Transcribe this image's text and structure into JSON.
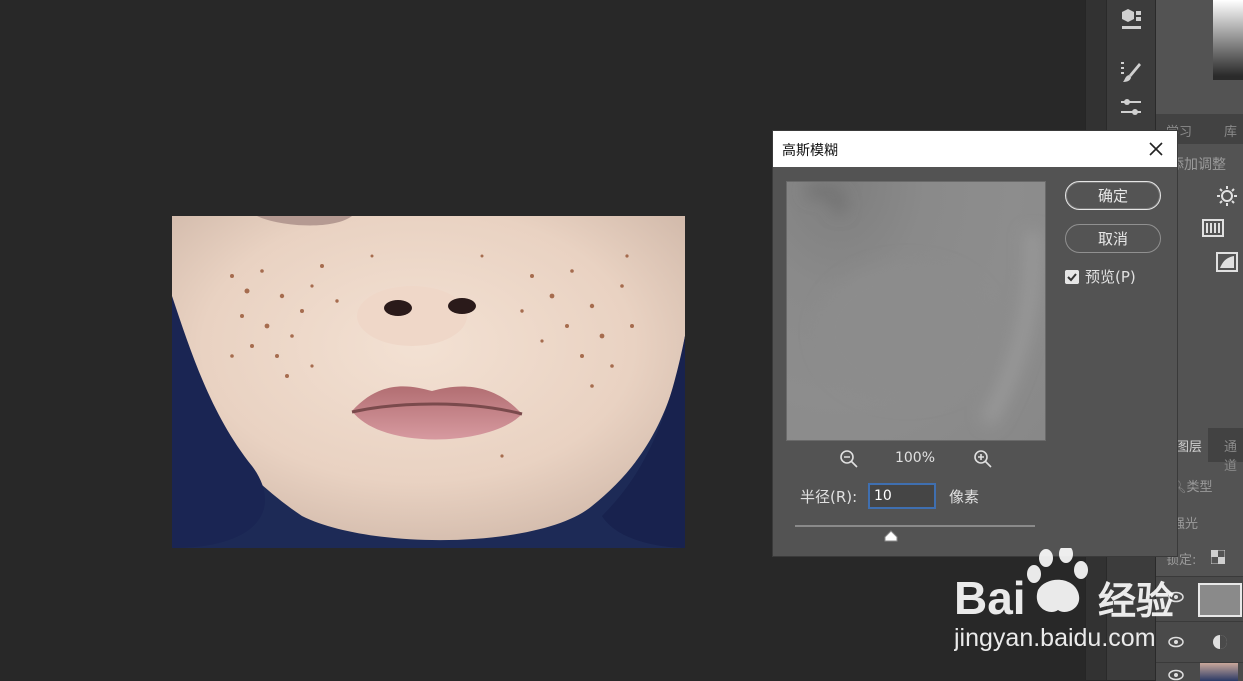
{
  "dialog": {
    "title": "高斯模糊",
    "ok_label": "确定",
    "cancel_label": "取消",
    "preview_label": "预览(P)",
    "preview_checked": true,
    "zoom": "100%",
    "radius_label": "半径(R):",
    "radius_value": "10",
    "radius_unit": "像素",
    "slider_value_fraction": 0.4
  },
  "right_panel": {
    "tabs": [
      "学习",
      "库"
    ],
    "adjust_title": "添加调整",
    "layer_tabs": [
      "图层",
      "通道"
    ],
    "filter_kind": "类型",
    "blend_mode": "强光",
    "lock_label": "锁定:"
  },
  "watermark": {
    "brand_a": "Bai",
    "brand_b": "经验",
    "url": "jingyan.baidu.com"
  },
  "icons": [
    "zoom-out-icon",
    "zoom-in-icon",
    "close-icon",
    "checkbox-checked-icon",
    "3d-icon",
    "brush-icon",
    "sliders-icon",
    "brightness-icon",
    "levels-icon",
    "exposure-icon",
    "eye-icon",
    "search-icon"
  ]
}
